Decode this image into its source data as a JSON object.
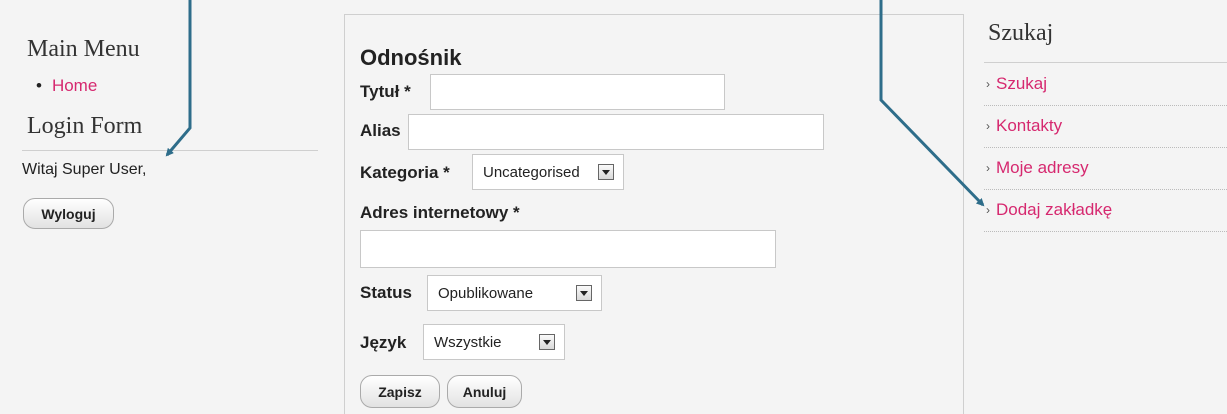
{
  "left": {
    "main_menu_title": "Main Menu",
    "home_bullet": "•",
    "home_label": "Home",
    "login_title": "Login Form",
    "welcome": "Witaj Super User,",
    "logout_label": "Wyloguj"
  },
  "form": {
    "title": "Odnośnik",
    "title_label": "Tytuł *",
    "title_value": "",
    "alias_label": "Alias",
    "alias_value": "",
    "category_label": "Kategoria *",
    "category_value": "Uncategorised",
    "url_label": "Adres internetowy *",
    "url_value": "",
    "status_label": "Status",
    "status_value": "Opublikowane",
    "language_label": "Język",
    "language_value": "Wszystkie",
    "save_label": "Zapisz",
    "cancel_label": "Anuluj"
  },
  "right": {
    "title": "Szukaj",
    "items": [
      {
        "label": "Szukaj"
      },
      {
        "label": "Kontakty"
      },
      {
        "label": "Moje adresy"
      },
      {
        "label": "Dodaj zakładkę"
      }
    ]
  },
  "colors": {
    "link": "#d6286f",
    "annotation_arrow": "#2e6d8a"
  }
}
